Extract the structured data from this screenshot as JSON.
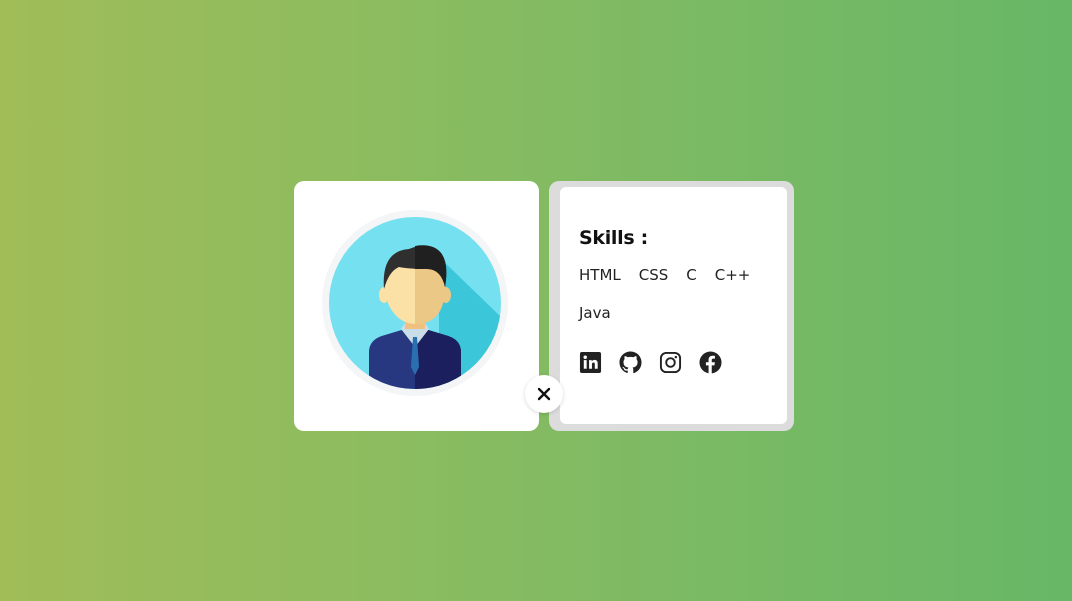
{
  "profile": {
    "avatar_icon": "person-avatar-icon"
  },
  "skills": {
    "title": "Skills :",
    "items": [
      "HTML",
      "CSS",
      "C",
      "C++",
      "Java"
    ]
  },
  "social": {
    "icons": [
      "linkedin-icon",
      "github-icon",
      "instagram-icon",
      "facebook-icon"
    ]
  },
  "close": {
    "icon": "close-icon"
  },
  "colors": {
    "background_start": "#a0bd58",
    "background_end": "#67b767",
    "card": "#ffffff",
    "card_border": "#dcdcdc",
    "icon": "#222222"
  }
}
